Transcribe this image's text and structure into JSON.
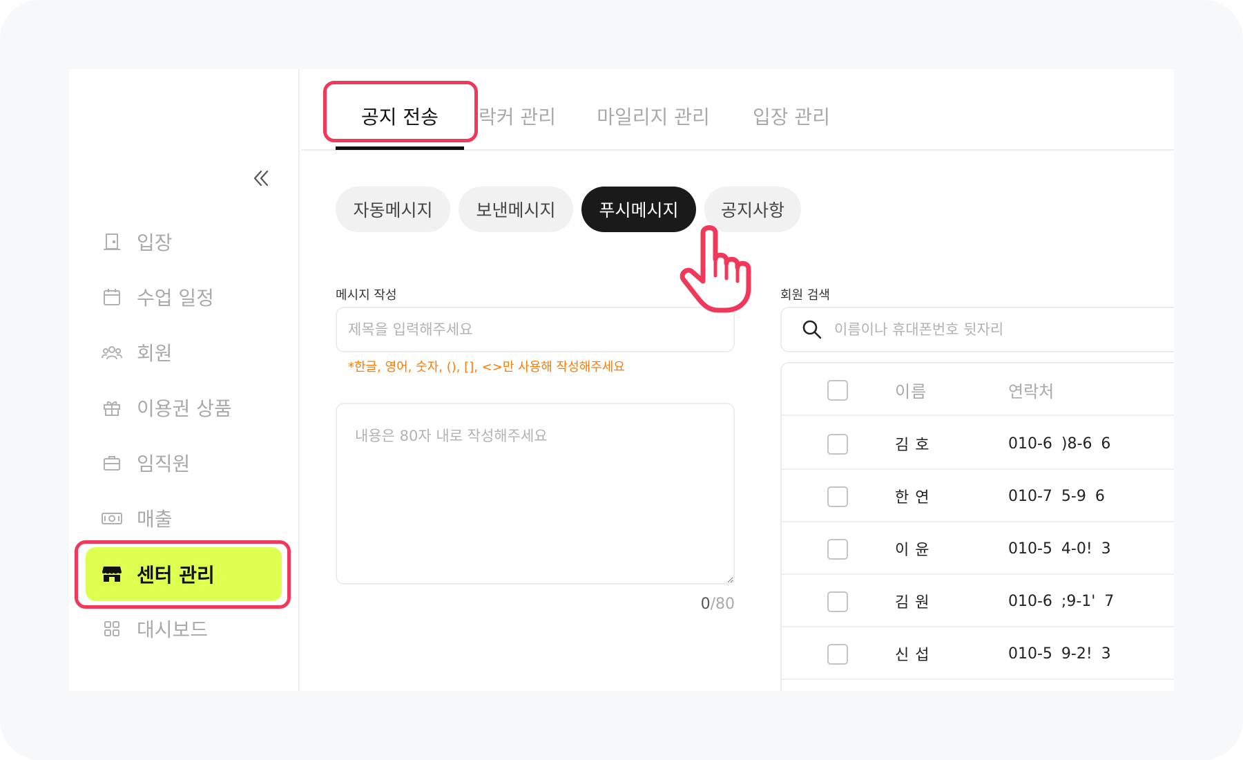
{
  "sidebar": {
    "collapse_icon": "double-chevron-left-icon",
    "items": [
      {
        "label": "입장",
        "icon": "door-icon",
        "active": false
      },
      {
        "label": "수업 일정",
        "icon": "calendar-icon",
        "active": false
      },
      {
        "label": "회원",
        "icon": "users-icon",
        "active": false
      },
      {
        "label": "이용권 상품",
        "icon": "gift-icon",
        "active": false
      },
      {
        "label": "임직원",
        "icon": "briefcase-icon",
        "active": false
      },
      {
        "label": "매출",
        "icon": "banknote-icon",
        "active": false
      },
      {
        "label": "센터 관리",
        "icon": "store-icon",
        "active": true
      },
      {
        "label": "대시보드",
        "icon": "grid-icon",
        "active": false
      }
    ]
  },
  "tabs": [
    {
      "label": "공지 전송",
      "active": true
    },
    {
      "label": "락커 관리",
      "active": false
    },
    {
      "label": "마일리지 관리",
      "active": false
    },
    {
      "label": "입장 관리",
      "active": false
    }
  ],
  "subtabs": [
    {
      "label": "자동메시지",
      "active": false
    },
    {
      "label": "보낸메시지",
      "active": false
    },
    {
      "label": "푸시메시지",
      "active": true
    },
    {
      "label": "공지사항",
      "active": false
    }
  ],
  "compose": {
    "section_label": "메시지 작성",
    "title_placeholder": "제목을 입력해주세요",
    "title_value": "",
    "hint": "*한글, 영어, 숫자, (), [], <>만 사용해 작성해주세요",
    "body_placeholder": "내용은 80자 내로 작성해주세요",
    "body_value": "",
    "count_current": "0",
    "count_max": "/80"
  },
  "member_search": {
    "section_label": "회원 검색",
    "placeholder": "이름이나 휴대폰번호 뒷자리",
    "value": "",
    "columns": {
      "name": "이름",
      "phone": "연락처"
    },
    "rows": [
      {
        "name": "김 호",
        "phone": "010-6 )8-6 6",
        "checked": false
      },
      {
        "name": "한 연",
        "phone": "010-7 5-9 6",
        "checked": false
      },
      {
        "name": "이 윤",
        "phone": "010-5 4-0! 3",
        "checked": false
      },
      {
        "name": "김 원",
        "phone": "010-6 ;9-1' 7",
        "checked": false
      },
      {
        "name": "신 섭",
        "phone": "010-5 9-2! 3",
        "checked": false
      }
    ]
  },
  "colors": {
    "accent_lime": "#dcff50",
    "highlight_red": "#f0385a",
    "hint_orange": "#ff7a00",
    "active_pill": "#1a1a1a"
  }
}
